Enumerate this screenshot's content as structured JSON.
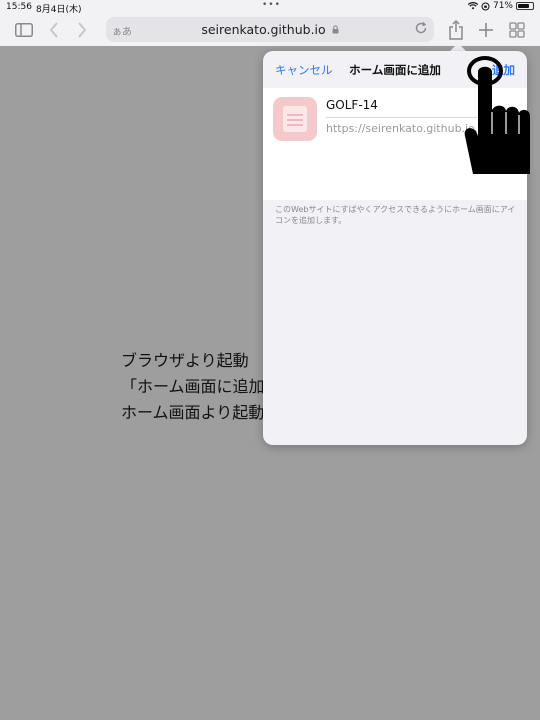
{
  "status_bar": {
    "time": "15:56",
    "date": "8月4日(木)",
    "battery": "71%",
    "battery_level": 0.71
  },
  "toolbar": {
    "text_size": "ぁあ",
    "url": "seirenkato.github.io",
    "icons": [
      "sidebar-icon",
      "back-icon",
      "forward-icon",
      "lock-icon",
      "reload-icon",
      "share-icon",
      "new-tab-icon",
      "tabs-grid-icon"
    ]
  },
  "page": {
    "lines": [
      "ブラウザより起動",
      "「ホーム画面に追加",
      "ホーム画面より起動"
    ]
  },
  "dialog": {
    "cancel": "キャンセル",
    "title": "ホーム画面に追加",
    "add": "追加",
    "app_name": "GOLF-14",
    "app_url": "https://seirenkato.github.io",
    "note": "このWebサイトにすばやくアクセスできるようにホーム画面にアイコンを追加します。"
  },
  "colors": {
    "accent": "#2b7cf2",
    "backdrop": "#9e9e9e",
    "icon_bg": "#f5c9cc"
  }
}
